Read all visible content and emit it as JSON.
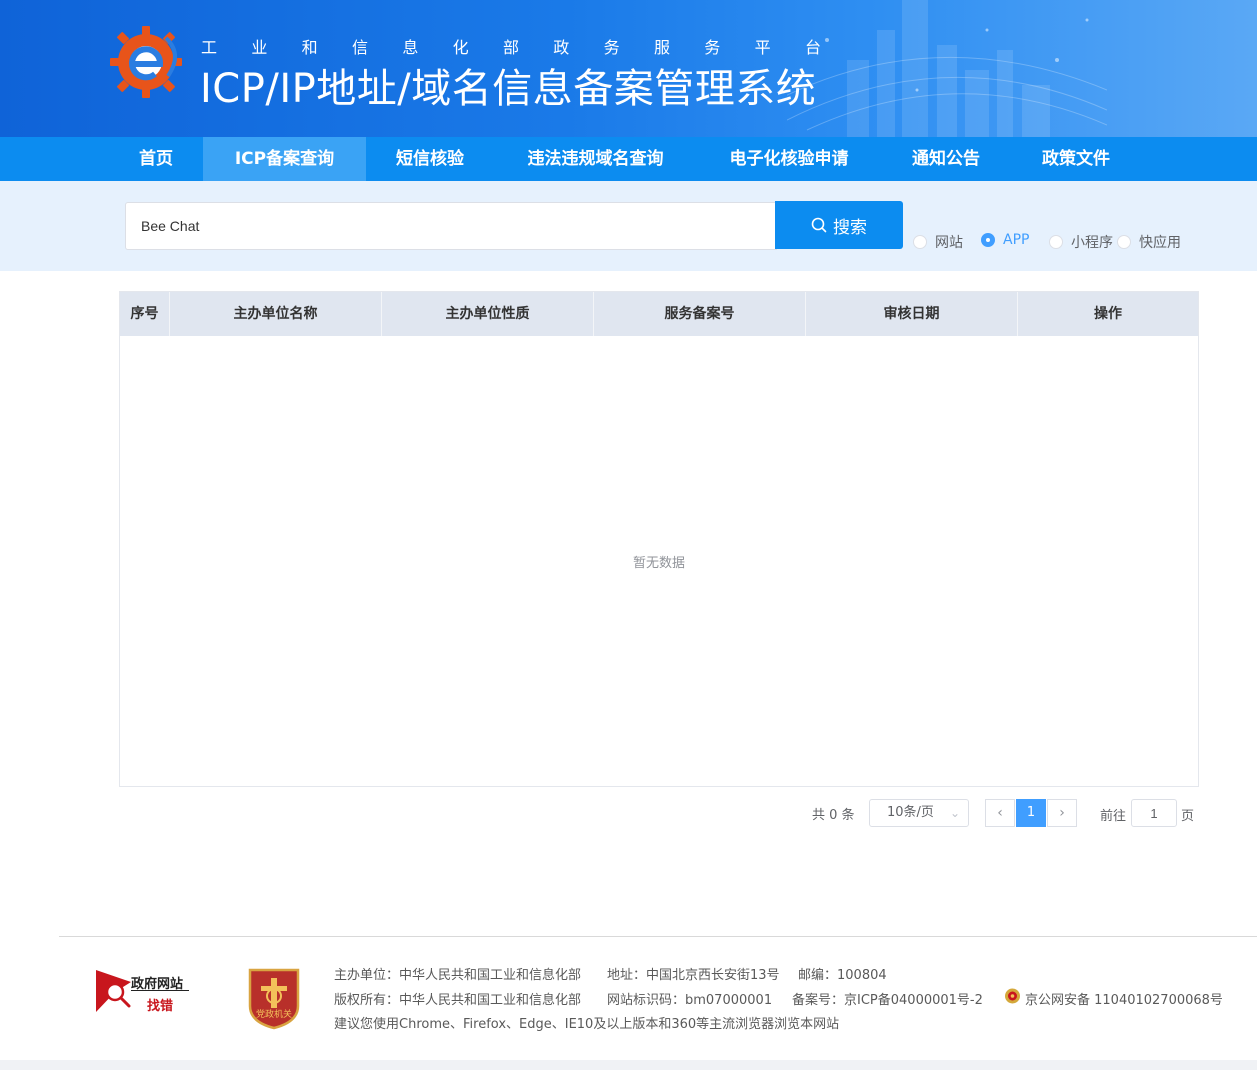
{
  "header": {
    "subtitle_chars": [
      "工",
      "业",
      "和",
      "信",
      "息",
      "化",
      "部",
      "政",
      "务",
      "服",
      "务",
      "平",
      "台"
    ],
    "title": "ICP/IP地址/域名信息备案管理系统"
  },
  "nav": {
    "items": [
      {
        "label": "首页"
      },
      {
        "label": "ICP备案查询"
      },
      {
        "label": "短信核验"
      },
      {
        "label": "违法违规域名查询"
      },
      {
        "label": "电子化核验申请"
      },
      {
        "label": "通知公告"
      },
      {
        "label": "政策文件"
      }
    ],
    "active_index": 1
  },
  "search": {
    "value": "Bee Chat",
    "button_label": "搜索",
    "types": [
      {
        "label": "网站",
        "checked": false
      },
      {
        "label": "APP",
        "checked": true
      },
      {
        "label": "小程序",
        "checked": false
      },
      {
        "label": "快应用",
        "checked": false
      }
    ]
  },
  "table": {
    "columns": [
      "序号",
      "主办单位名称",
      "主办单位性质",
      "服务备案号",
      "审核日期",
      "操作"
    ],
    "rows": [],
    "empty_text": "暂无数据"
  },
  "pagination": {
    "total_text": "共 0 条",
    "page_size": "10条/页",
    "current_page": "1",
    "goto_label": "前往",
    "goto_value": "1",
    "page_suffix": "页"
  },
  "footer": {
    "gov_badge_line1": "政府网站",
    "gov_badge_line2": "找错",
    "party_badge": "党政机关",
    "line1_host": "主办单位：中华人民共和国工业和信息化部",
    "line1_address": "地址：中国北京西长安街13号",
    "line1_postcode": "邮编：100804",
    "line2_copyright": "版权所有：中华人民共和国工业和信息化部",
    "line2_site_id": "网站标识码：bm07000001",
    "line2_icp": "备案号：京ICP备04000001号-2",
    "line2_police": "京公网安备 11040102700068号",
    "line3_browser": "建议您使用Chrome、Firefox、Edge、IE10及以上版本和360等主流浏览器浏览本网站"
  },
  "colors": {
    "nav_bg": "#0c8cf0",
    "nav_active": "#3aa3f5",
    "accent": "#409eff",
    "header_dark": "#0f63d8"
  }
}
